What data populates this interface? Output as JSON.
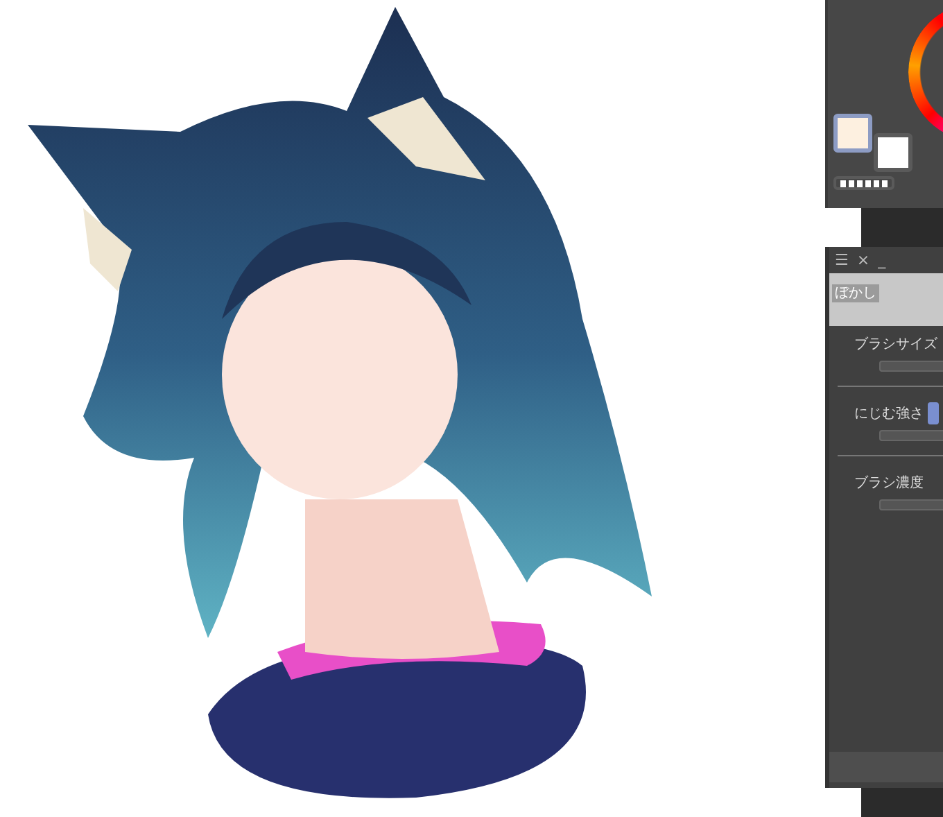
{
  "color_panel": {
    "swatches": [
      {
        "kind": "main",
        "selected": true,
        "color": "#fdf0e0"
      },
      {
        "kind": "sub",
        "selected": false,
        "color": "#ffffff"
      },
      {
        "kind": "transparent",
        "selected": false
      }
    ]
  },
  "tool_property": {
    "header_icons": [
      "☰",
      "×",
      "_"
    ],
    "tool_name": "ぼかし",
    "settings": [
      {
        "kind": "slider",
        "label": "ブラシサイズ"
      },
      {
        "kind": "slider_with_button",
        "label": "にじむ強さ"
      },
      {
        "kind": "slider",
        "label": "ブラシ濃度"
      }
    ]
  }
}
